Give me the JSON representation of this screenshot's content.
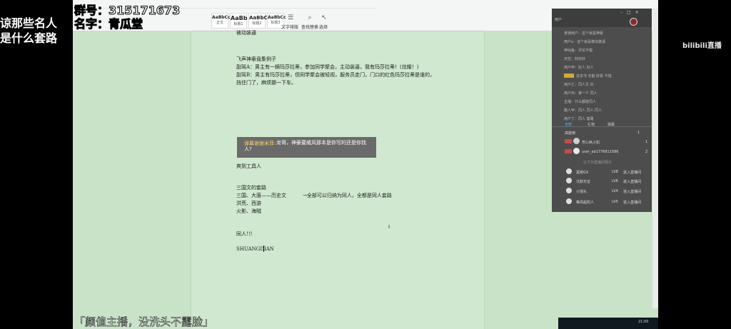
{
  "overlay": {
    "group_line": "群号：315171673",
    "name_line": "名字：青瓜堂",
    "left_line1": "谅那些名人",
    "left_line2": "是什么套路",
    "bilibili": "bilibili直播",
    "slogan": "「颜值主播，没洗头不露脸」"
  },
  "ribbon": {
    "style_samples": [
      "AaBbCcDd",
      "AaBb",
      "AaBbC",
      "AaBbCc"
    ],
    "style_names": [
      "正文",
      "标题1",
      "标题2",
      "标题3"
    ],
    "tools": [
      "文字排版",
      "查找替换",
      "选择"
    ]
  },
  "document": {
    "lines": [
      "被动装逼",
      "飞声神豪竟集例子",
      "副驾A：男主有一辆玛莎拉蒂，参加同学聚会，主动装逼，我有玛莎拉蒂！(炫耀！)",
      "副驾B：男主有玛莎拉蒂，但同学聚会被轻视，服务员走门，门口的红色玛莎拉蒂是谁的，",
      "挡住门了，麻烦挪一下车。",
      "爽到工具人",
      "三国文的套路",
      "三国、大唐——历史文",
      "→全部可以归纳为同人，全都是同人套路",
      "洪荒、西游",
      "火影、海贼",
      "同人!!!",
      "SHUANGDIAN"
    ],
    "comment_tag": "弹幕谢谢米菲:",
    "comment_text": "龙哥，神豪要威风那本是你写的还是你找人?"
  },
  "chat": {
    "header": "用户",
    "messages": [
      "普通用户：这个就是神豪",
      "用户a：这个就是被动装逼",
      "神仙鱼：评论不错",
      "天空：好好好",
      "用户甲：好人 好人",
      "这本书 无敌 好看 不错",
      "用户乙：同人文 好",
      "用户丙：第一个 同人",
      "主播：什么都能同人",
      "路人甲：同人 同人 同人",
      "用户丁：同人 套路"
    ],
    "tabs": [
      "全部",
      "礼物",
      "弹幕"
    ],
    "gift_header": "高能榜",
    "gift_count": "1",
    "gifts": [
      {
        "name": "芳心纵火犯",
        "num": "1"
      },
      {
        "name": "user_ab1776811586",
        "num": "2"
      }
    ],
    "divider": "以下为直播间观众",
    "viewers": [
      {
        "name": "黑炭GX",
        "level": "LV8",
        "action": "进入直播间"
      },
      {
        "name": "沉默无言",
        "level": "LV6",
        "action": "进入直播间"
      },
      {
        "name": "小馒头",
        "level": "LV4",
        "action": "进入直播间"
      },
      {
        "name": "等风起的人",
        "level": "LV5",
        "action": "进入直播间"
      }
    ]
  },
  "taskbar": {
    "time": "21:00"
  }
}
